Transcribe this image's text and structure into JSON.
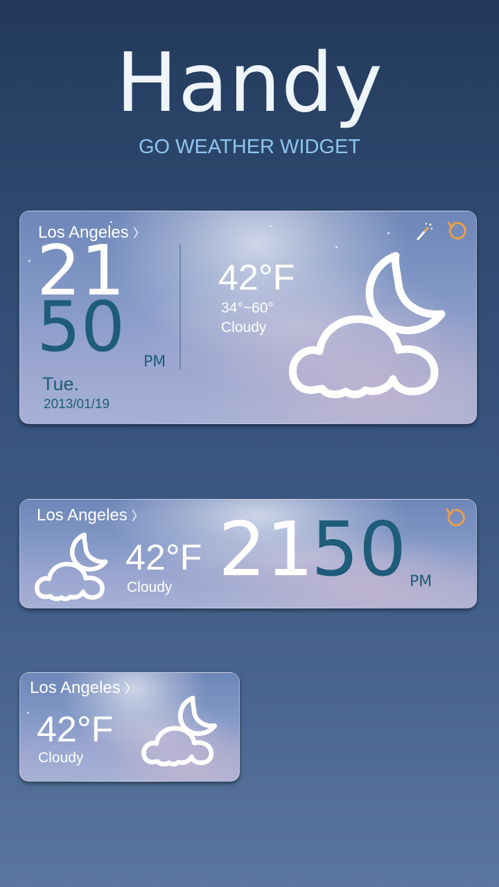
{
  "header": {
    "title": "Handy",
    "subtitle": "GO WEATHER WIDGET"
  },
  "widget_large": {
    "city": "Los Angeles",
    "chevron": "〉",
    "hour": "21",
    "minute": "50",
    "ampm": "PM",
    "day": "Tue.",
    "date": "2013/01/19",
    "temp": "42°F",
    "range": "34°~60°",
    "condition": "Cloudy",
    "icons": [
      "magic-wand-icon",
      "refresh-icon",
      "cloudy-night-icon"
    ]
  },
  "widget_medium": {
    "city": "Los Angeles",
    "chevron": "〉",
    "temp": "42°F",
    "condition": "Cloudy",
    "hour": "21",
    "minute": "50",
    "ampm": "PM",
    "icons": [
      "refresh-icon",
      "cloudy-night-icon"
    ]
  },
  "widget_small": {
    "city": "Los Angeles",
    "chevron": "〉",
    "temp": "42°F",
    "condition": "Cloudy",
    "icons": [
      "cloudy-night-icon"
    ]
  },
  "colors": {
    "time_dark": "#1e5c78",
    "accent_orange": "#e8a04a",
    "subtitle_blue": "#8fc6ef"
  }
}
